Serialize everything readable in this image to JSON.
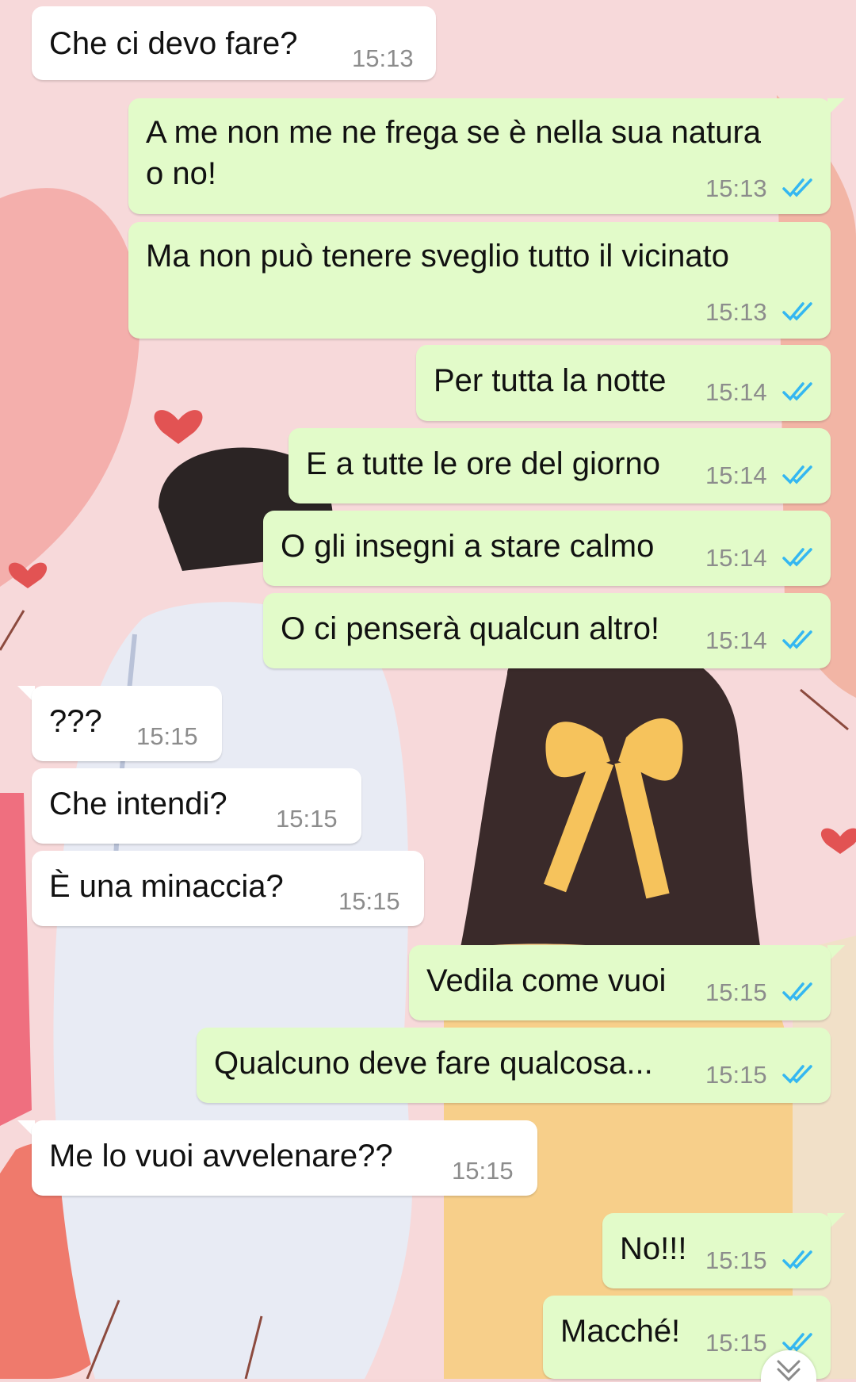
{
  "colors": {
    "header": "#1f5f55",
    "incoming_bubble": "#ffffff",
    "outgoing_bubble": "#e2fbc9",
    "read_receipt": "#34b7f1",
    "wallpaper": "#f6d7d8"
  },
  "messages": [
    {
      "dir": "in",
      "text": "Che ci devo fare?",
      "time": "15:13"
    },
    {
      "dir": "out",
      "text": "A me non me ne frega se è nella sua natura",
      "text2": "o no!",
      "time": "15:13",
      "status": "read"
    },
    {
      "dir": "out",
      "text": "Ma non può tenere sveglio tutto il vicinato",
      "time": "15:13",
      "status": "read"
    },
    {
      "dir": "out",
      "text": "Per tutta la notte",
      "time": "15:14",
      "status": "read"
    },
    {
      "dir": "out",
      "text": "E a tutte le ore del giorno",
      "time": "15:14",
      "status": "read"
    },
    {
      "dir": "out",
      "text": "O gli insegni a stare calmo",
      "time": "15:14",
      "status": "read"
    },
    {
      "dir": "out",
      "text": "O ci penserà qualcun altro!",
      "time": "15:14",
      "status": "read"
    },
    {
      "dir": "in",
      "text": "???",
      "time": "15:15"
    },
    {
      "dir": "in",
      "text": "Che intendi?",
      "time": "15:15"
    },
    {
      "dir": "in",
      "text": "È una minaccia?",
      "time": "15:15"
    },
    {
      "dir": "out",
      "text": "Vedila come vuoi",
      "time": "15:15",
      "status": "read"
    },
    {
      "dir": "out",
      "text": "Qualcuno deve fare qualcosa...",
      "time": "15:15",
      "status": "read"
    },
    {
      "dir": "in",
      "text": "Me lo vuoi avvelenare??",
      "time": "15:15"
    },
    {
      "dir": "out",
      "text": "No!!!",
      "time": "15:15",
      "status": "read"
    },
    {
      "dir": "out",
      "text": "Macché!",
      "time": "15:15",
      "status": "read"
    }
  ],
  "icons": {
    "read_receipt": "double-check-icon",
    "scroll_down": "chevron-down-icon",
    "heart": "heart-icon"
  }
}
